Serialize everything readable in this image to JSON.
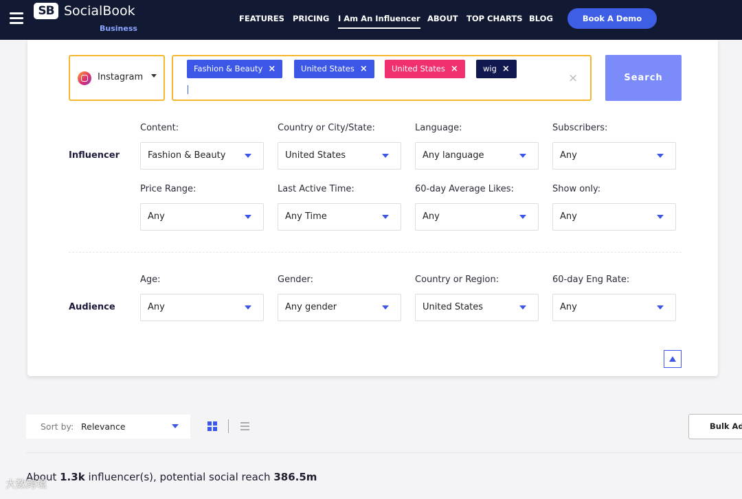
{
  "nav": {
    "brand": "SocialBook",
    "brand_mark": "SB",
    "brand_sub": "Business",
    "links": [
      "FEATURES",
      "PRICING",
      "I Am An Influencer",
      "ABOUT",
      "TOP CHARTS",
      "BLOG"
    ],
    "active_link": "I Am An Influencer",
    "demo_button": "Book A Demo"
  },
  "search": {
    "platform": "Instagram",
    "tags": [
      {
        "label": "Fashion & Beauty",
        "color": "#3c57e8"
      },
      {
        "label": "United States",
        "color": "#3c57e8"
      },
      {
        "label": "United States",
        "color": "#f0306f"
      },
      {
        "label": "wig",
        "color": "#10184f"
      }
    ],
    "tag_remove": "×",
    "clear": "×",
    "button": "Search"
  },
  "influencer": {
    "section_label": "Influencer",
    "filters": [
      {
        "label": "Content:",
        "value": "Fashion & Beauty"
      },
      {
        "label": "Country or City/State:",
        "value": "United States"
      },
      {
        "label": "Language:",
        "value": "Any language"
      },
      {
        "label": "Subscribers:",
        "value": "Any"
      },
      {
        "label": "Price Range:",
        "value": "Any"
      },
      {
        "label": "Last Active Time:",
        "value": "Any Time"
      },
      {
        "label": "60-day Average Likes:",
        "value": "Any"
      },
      {
        "label": "Show only:",
        "value": "Any"
      }
    ]
  },
  "audience": {
    "section_label": "Audience",
    "filters": [
      {
        "label": "Age:",
        "value": "Any"
      },
      {
        "label": "Gender:",
        "value": "Any gender"
      },
      {
        "label": "Country or Region:",
        "value": "United States"
      },
      {
        "label": "60-day Eng Rate:",
        "value": "Any"
      }
    ]
  },
  "results": {
    "sort_label": "Sort by:",
    "sort_value": "Relevance",
    "bulk_button": "Bulk Ad",
    "summary_prefix": "About ",
    "count": "1.3k",
    "summary_mid": " influencer(s), potential social reach ",
    "reach": "386.5m"
  },
  "watermark": "大数跨境",
  "colors": {
    "accent": "#3c57e8",
    "nav_bg": "#121a33",
    "highlight_border": "#f5b72e",
    "search_button": "#7b8bfa"
  }
}
